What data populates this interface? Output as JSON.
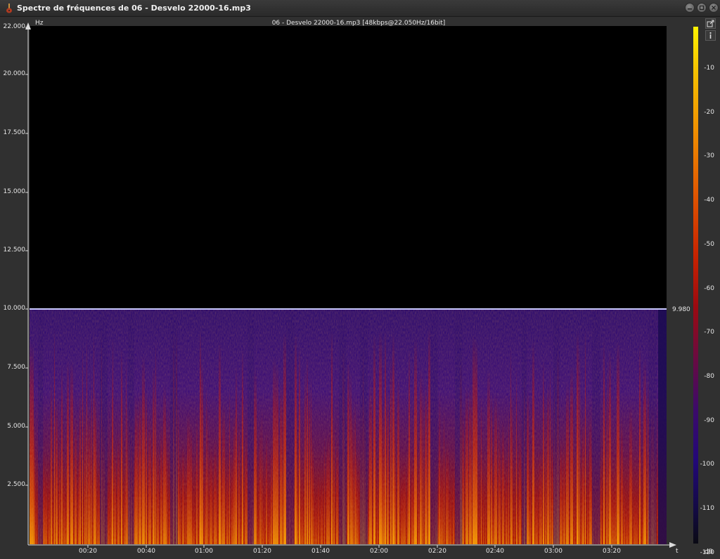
{
  "window": {
    "title": "Spectre de fréquences de 06 - Desvelo 22000-16.mp3"
  },
  "plot": {
    "file_info": "06 - Desvelo 22000-16.mp3 [48kbps@22.050Hz/16bit]",
    "y_unit": "Hz",
    "x_unit": "t",
    "cutoff_label": "9.980",
    "y_ticks": [
      "22.000",
      "20.000",
      "17.500",
      "15.000",
      "12.500",
      "10.000",
      "7.500",
      "5.000",
      "2.500"
    ],
    "x_ticks": [
      "00:20",
      "00:40",
      "01:00",
      "01:20",
      "01:40",
      "02:00",
      "02:20",
      "02:40",
      "03:00",
      "03:20"
    ]
  },
  "colorbar": {
    "unit": "dB",
    "ticks": [
      "-10",
      "-20",
      "-30",
      "-40",
      "-50",
      "-60",
      "-70",
      "-80",
      "-90",
      "-100",
      "-110",
      "-120"
    ],
    "colors": {
      "top": "#fff200",
      "mid": "#c82400",
      "low": "#220878",
      "bottom": "#0a0a14"
    }
  },
  "icons": {
    "app": "guitar-icon",
    "export": "external-link-icon",
    "info": "info-icon",
    "minimize": "minimize-icon",
    "maximize": "maximize-icon",
    "close": "close-icon"
  }
}
